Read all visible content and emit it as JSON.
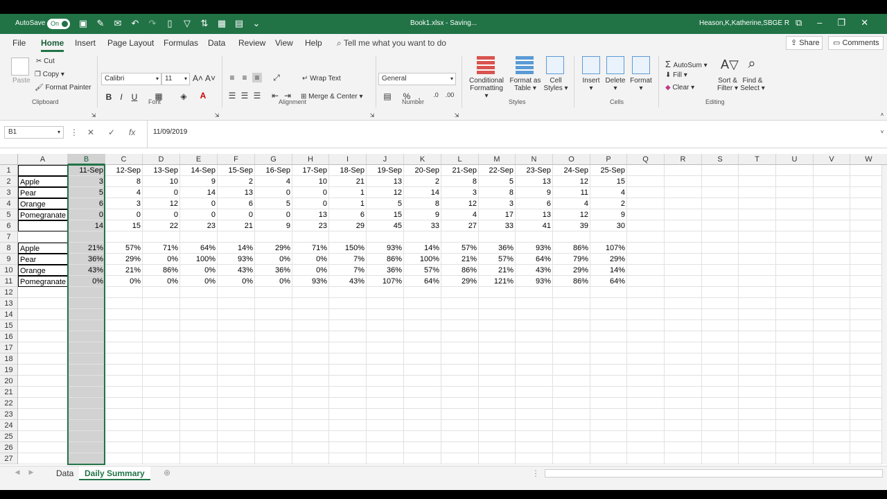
{
  "titlebar": {
    "autosave_label": "AutoSave",
    "autosave_state": "On",
    "doc_title": "Book1.xlsx  -  Saving...",
    "user": "Heason,K,Katherine,SBGE R"
  },
  "menu": {
    "tabs": [
      "File",
      "Home",
      "Insert",
      "Page Layout",
      "Formulas",
      "Data",
      "Review",
      "View",
      "Help"
    ],
    "active_tab": "Home",
    "tellme": "Tell me what you want to do",
    "share": "Share",
    "comments": "Comments"
  },
  "ribbon": {
    "clipboard": {
      "paste": "Paste",
      "cut": "Cut",
      "copy": "Copy",
      "format_painter": "Format Painter",
      "label": "Clipboard"
    },
    "font": {
      "name": "Calibri",
      "size": "11",
      "bold": "B",
      "italic": "I",
      "underline": "U",
      "label": "Font"
    },
    "alignment": {
      "wrap": "Wrap Text",
      "merge": "Merge & Center",
      "label": "Alignment"
    },
    "number": {
      "format": "General",
      "label": "Number"
    },
    "styles": {
      "conditional_1": "Conditional",
      "conditional_2": "Formatting",
      "format_as_1": "Format as",
      "format_as_2": "Table",
      "cell_1": "Cell",
      "cell_2": "Styles",
      "label": "Styles"
    },
    "cells": {
      "insert": "Insert",
      "delete": "Delete",
      "format": "Format",
      "label": "Cells"
    },
    "editing": {
      "autosum": "AutoSum",
      "fill": "Fill",
      "clear": "Clear",
      "sort_1": "Sort &",
      "sort_2": "Filter",
      "find_1": "Find &",
      "find_2": "Select",
      "label": "Editing"
    }
  },
  "formula_bar": {
    "name_box": "B1",
    "value": "11/09/2019"
  },
  "columns": [
    "A",
    "B",
    "C",
    "D",
    "E",
    "F",
    "G",
    "H",
    "I",
    "J",
    "K",
    "L",
    "M",
    "N",
    "O",
    "P",
    "Q",
    "R",
    "S",
    "T",
    "U",
    "V",
    "W"
  ],
  "selected_column": "B",
  "rows": [
    [
      "",
      "11-Sep",
      "12-Sep",
      "13-Sep",
      "14-Sep",
      "15-Sep",
      "16-Sep",
      "17-Sep",
      "18-Sep",
      "19-Sep",
      "20-Sep",
      "21-Sep",
      "22-Sep",
      "23-Sep",
      "24-Sep",
      "25-Sep"
    ],
    [
      "Apple",
      "3",
      "8",
      "10",
      "9",
      "2",
      "4",
      "10",
      "21",
      "13",
      "2",
      "8",
      "5",
      "13",
      "12",
      "15"
    ],
    [
      "Pear",
      "5",
      "4",
      "0",
      "14",
      "13",
      "0",
      "0",
      "1",
      "12",
      "14",
      "3",
      "8",
      "9",
      "11",
      "4"
    ],
    [
      "Orange",
      "6",
      "3",
      "12",
      "0",
      "6",
      "5",
      "0",
      "1",
      "5",
      "8",
      "12",
      "3",
      "6",
      "4",
      "2"
    ],
    [
      "Pomegranate",
      "0",
      "0",
      "0",
      "0",
      "0",
      "0",
      "13",
      "6",
      "15",
      "9",
      "4",
      "17",
      "13",
      "12",
      "9"
    ],
    [
      "",
      "14",
      "15",
      "22",
      "23",
      "21",
      "9",
      "23",
      "29",
      "45",
      "33",
      "27",
      "33",
      "41",
      "39",
      "30"
    ],
    [
      "",
      "",
      "",
      "",
      "",
      "",
      "",
      "",
      "",
      "",
      "",
      "",
      "",
      "",
      "",
      ""
    ],
    [
      "Apple",
      "21%",
      "57%",
      "71%",
      "64%",
      "14%",
      "29%",
      "71%",
      "150%",
      "93%",
      "14%",
      "57%",
      "36%",
      "93%",
      "86%",
      "107%"
    ],
    [
      "Pear",
      "36%",
      "29%",
      "0%",
      "100%",
      "93%",
      "0%",
      "0%",
      "7%",
      "86%",
      "100%",
      "21%",
      "57%",
      "64%",
      "79%",
      "29%"
    ],
    [
      "Orange",
      "43%",
      "21%",
      "86%",
      "0%",
      "43%",
      "36%",
      "0%",
      "7%",
      "36%",
      "57%",
      "86%",
      "21%",
      "43%",
      "29%",
      "14%"
    ],
    [
      "Pomegranate",
      "0%",
      "0%",
      "0%",
      "0%",
      "0%",
      "0%",
      "93%",
      "43%",
      "107%",
      "64%",
      "29%",
      "121%",
      "93%",
      "86%",
      "64%"
    ]
  ],
  "row_count": 27,
  "sheets": [
    "Data",
    "Daily Summary"
  ],
  "active_sheet": "Daily Summary",
  "colors": {
    "excel_green": "#217346",
    "dark_green": "#185c37"
  }
}
